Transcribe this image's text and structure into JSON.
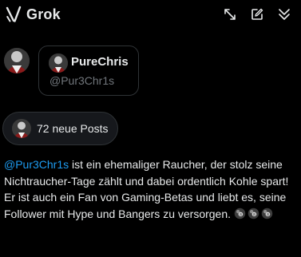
{
  "app": {
    "title": "Grok"
  },
  "header": {
    "actions": [
      "expand-icon",
      "edit-icon",
      "collapse-icon"
    ]
  },
  "profile_card": {
    "name": "PureChris",
    "handle": "@Pur3Chr1s"
  },
  "posts_pill": {
    "label": "72 neue Posts"
  },
  "post": {
    "mention": "@Pur3Chr1s",
    "text": " ist ein ehemaliger Raucher, der stolz seine Nichtraucher-Tage zählt und dabei ordentlich Kohle spart! Er ist auch ein Fan von Gaming-Betas und liebt es, seine Follower mit Hype und Bangers zu versorgen. ",
    "emojis": [
      "8-ball-emoji",
      "8-ball-emoji",
      "8-ball-emoji"
    ]
  },
  "colors": {
    "background": "#000000",
    "text": "#e7e9ea",
    "muted": "#71767b",
    "border": "#2f3336",
    "accent": "#1d9bf0",
    "pill_bg": "#16181c"
  }
}
